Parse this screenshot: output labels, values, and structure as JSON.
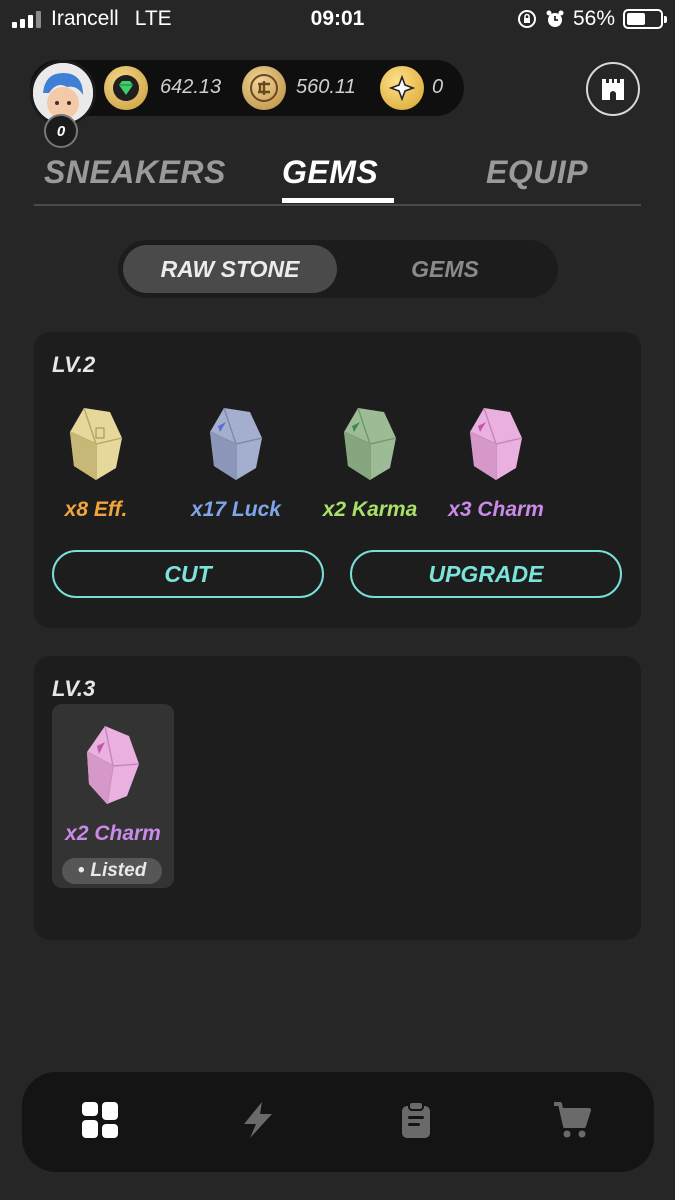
{
  "status_bar": {
    "carrier": "Irancell",
    "network": "LTE",
    "time": "09:01",
    "battery_percent_text": "56%",
    "battery_level": 0.56
  },
  "wallet": {
    "avatar_badge": "0",
    "gem_balance": "642.13",
    "gst_balance": "560.11",
    "star_balance": "0"
  },
  "main_tabs": [
    {
      "label": "SNEAKERS",
      "active": false
    },
    {
      "label": "GEMS",
      "active": true
    },
    {
      "label": "EQUIP",
      "active": false
    }
  ],
  "segmented": {
    "raw_stone": "RAW STONE",
    "gems": "GEMS",
    "active": "RAW STONE"
  },
  "cards": {
    "lv2": {
      "title": "LV.2",
      "stones": [
        {
          "label": "x8 Eff.",
          "color": "#f0a53a",
          "stone_color": "#e6d79a"
        },
        {
          "label": "x17 Luck",
          "color": "#7fa6e8",
          "stone_color": "#9aa6c8"
        },
        {
          "label": "x2 Karma",
          "color": "#a8e06a",
          "stone_color": "#98b892"
        },
        {
          "label": "x3 Charm",
          "color": "#c98ae8",
          "stone_color": "#e8a6dc"
        }
      ],
      "cut_label": "CUT",
      "upgrade_label": "UPGRADE"
    },
    "lv3": {
      "title": "LV.3",
      "item": {
        "label": "x2 Charm",
        "color": "#c98ae8",
        "status": "Listed"
      }
    }
  },
  "colors": {
    "background": "#262626",
    "card": "#1d1d1d",
    "accent_teal": "#78e0d8"
  },
  "bottom_nav": [
    "grid-icon",
    "lightning-icon",
    "clipboard-icon",
    "cart-icon"
  ]
}
